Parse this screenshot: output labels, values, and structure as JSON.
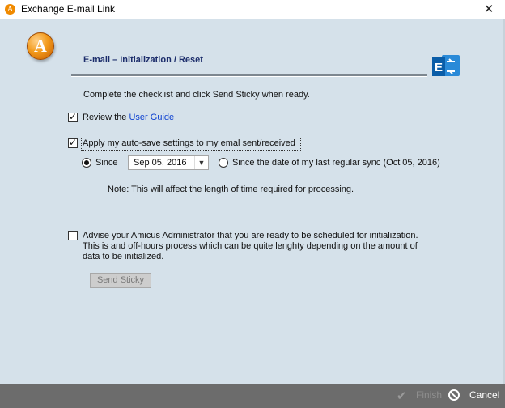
{
  "window": {
    "title": "Exchange E-mail Link",
    "app_icon_letter": "A"
  },
  "header": {
    "logo_letter": "A",
    "title": "E-mail – Initialization / Reset"
  },
  "instructions": "Complete the checklist and click Send Sticky when ready.",
  "checklist": {
    "review": {
      "checked": true,
      "label": "Review the ",
      "link": "User Guide"
    },
    "autosave": {
      "checked": true,
      "label": "Apply my auto-save settings to my emal sent/received"
    }
  },
  "since_option": {
    "selected": true,
    "label": "Since",
    "date_value": "Sep 05, 2016"
  },
  "last_sync_option": {
    "selected": false,
    "label": "Since the date of my last regular sync (Oct 05, 2016)"
  },
  "note": "Note: This will affect the length of time required for processing.",
  "advise": {
    "checked": false,
    "label": "Advise your Amicus Administrator that you are ready to be scheduled for initialization. This is and off-hours process which can be quite lenghty depending on the amount of data to be initialized."
  },
  "buttons": {
    "send_sticky": "Send Sticky",
    "finish": "Finish",
    "cancel": "Cancel"
  },
  "colors": {
    "client_bg": "#d5e1ea",
    "heading": "#1c2d6b",
    "link": "#0b3fd0",
    "footer_bg": "#6c6c6c",
    "exchange_blue": "#0a72c6"
  }
}
